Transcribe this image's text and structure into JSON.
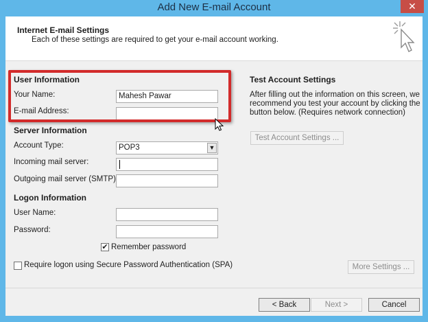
{
  "window": {
    "title": "Add New E-mail Account",
    "close_glyph": "✕"
  },
  "header": {
    "title": "Internet E-mail Settings",
    "subtitle": "Each of these settings are required to get your e-mail account working."
  },
  "user_info": {
    "section": "User Information",
    "name_label": "Your Name:",
    "name_value": "Mahesh Pawar",
    "email_label": "E-mail Address:",
    "email_value": ""
  },
  "server_info": {
    "section": "Server Information",
    "account_type_label": "Account Type:",
    "account_type_value": "POP3",
    "incoming_label": "Incoming mail server:",
    "incoming_value": "",
    "outgoing_label": "Outgoing mail server (SMTP):",
    "outgoing_value": ""
  },
  "logon_info": {
    "section": "Logon Information",
    "username_label": "User Name:",
    "username_value": "",
    "password_label": "Password:",
    "password_value": "",
    "remember_label": "Remember password",
    "remember_checked": true,
    "spa_label": "Require logon using Secure Password Authentication (SPA)",
    "spa_checked": false
  },
  "test_settings": {
    "section": "Test Account Settings",
    "description_line1": "After filling out the information on this screen, we",
    "description_line2": "recommend you test your account by clicking the",
    "description_line3": "button below. (Requires network connection)",
    "button": "Test Account Settings ..."
  },
  "buttons": {
    "more_settings": "More Settings ...",
    "back": "< Back",
    "next": "Next >",
    "cancel": "Cancel"
  },
  "colors": {
    "title_bar": "#5fb7e8",
    "highlight_border": "#d22b2b",
    "close_button": "#c74e46"
  }
}
